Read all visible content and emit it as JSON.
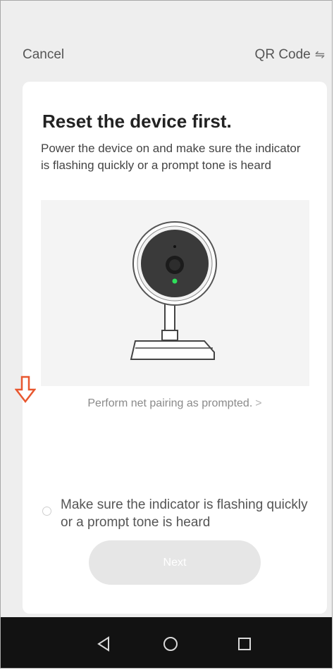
{
  "header": {
    "cancel_label": "Cancel",
    "qr_label": "QR Code",
    "qr_icon": "swap-arrows-icon"
  },
  "card": {
    "title": "Reset the device first.",
    "description": "Power the device on and make sure the indicator is flashing quickly or a prompt tone is heard",
    "illustration": "security-camera-illustration",
    "pairing_link": "Perform net pairing as prompted.",
    "pairing_chevron": ">",
    "confirm_text": "Make sure the indicator is flashing quickly or a prompt tone is heard",
    "confirm_checked": false,
    "next_label": "Next"
  },
  "annotation": {
    "icon": "down-arrow-icon",
    "color": "#e8572f"
  },
  "navbar": {
    "icons": [
      "back-triangle-icon",
      "home-circle-icon",
      "recents-square-icon"
    ]
  },
  "colors": {
    "background": "#eeeeee",
    "card": "#ffffff",
    "button_disabled": "#e6e6e6",
    "navbar": "#121212"
  }
}
